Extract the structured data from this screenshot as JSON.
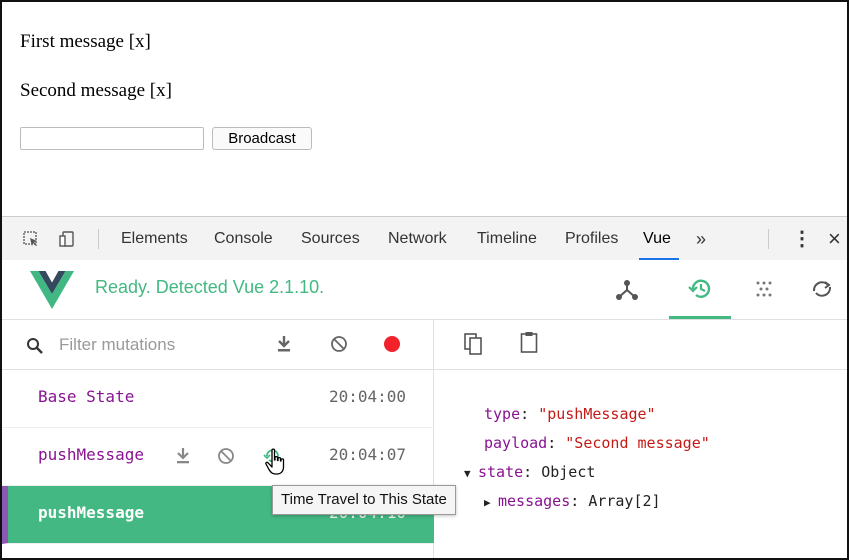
{
  "page": {
    "messages": [
      "First message [x]",
      "Second message [x]"
    ],
    "input_value": "",
    "broadcast_label": "Broadcast"
  },
  "devtools": {
    "tabs": [
      "Elements",
      "Console",
      "Sources",
      "Network",
      "Timeline",
      "Profiles",
      "Vue"
    ],
    "active_tab": "Vue",
    "more_label": "»",
    "menu_label": "⋮",
    "close_label": "×"
  },
  "vue": {
    "status": "Ready. Detected Vue 2.1.10.",
    "accent_color": "#42b983"
  },
  "mutations": {
    "filter_placeholder": "Filter mutations",
    "rows": [
      {
        "name": "Base State",
        "time": "20:04:00"
      },
      {
        "name": "pushMessage",
        "time": "20:04:07"
      },
      {
        "name": "pushMessage",
        "time": "20:04:10"
      }
    ]
  },
  "inspector": {
    "type_key": "type",
    "type_value": "\"pushMessage\"",
    "payload_key": "payload",
    "payload_value": "\"Second message\"",
    "state_key": "state",
    "state_value": "Object",
    "messages_key": "messages",
    "messages_value": "Array[2]"
  },
  "tooltip": "Time Travel to This State",
  "icons": [
    "inspect-icon",
    "device-icon",
    "components-icon",
    "time-travel-icon",
    "vuex-icon",
    "refresh-icon",
    "search-icon",
    "download-icon",
    "block-icon",
    "record-icon",
    "copy-icon",
    "paste-icon",
    "cursor-hand-icon"
  ]
}
